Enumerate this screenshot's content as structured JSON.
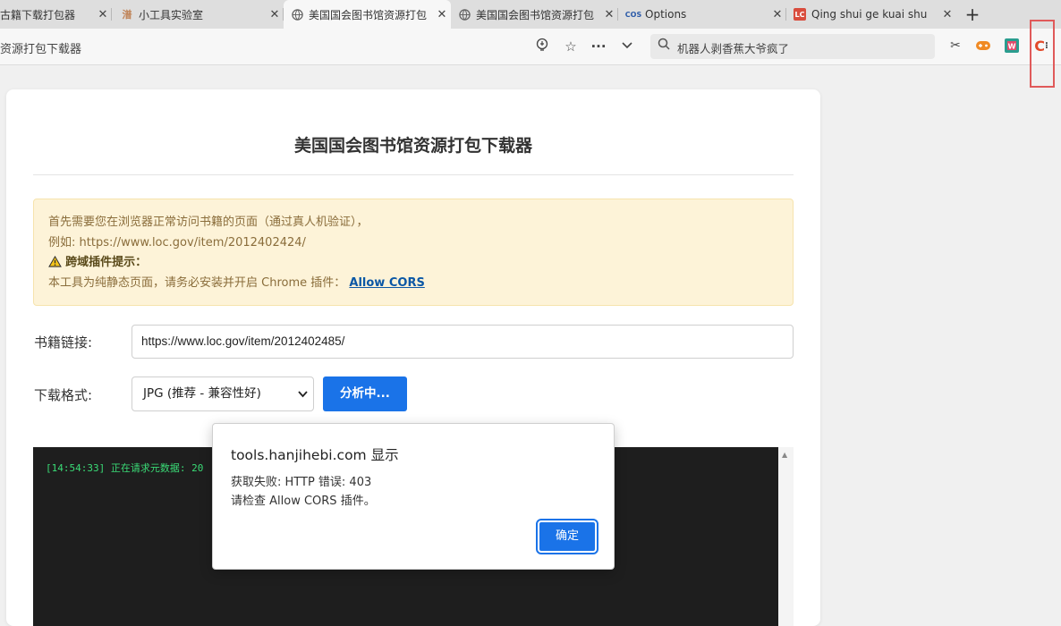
{
  "browser": {
    "tabs": [
      {
        "title": "古籍下载打包器",
        "favicon": "page-icon"
      },
      {
        "title": "小工具实验室",
        "favicon": "han-icon",
        "favicon_text": "潽"
      },
      {
        "title": "美国国会图书馆资源打包",
        "favicon": "globe-icon"
      },
      {
        "title": "美国国会图书馆资源打包",
        "favicon": "globe-icon"
      },
      {
        "title": "Options",
        "favicon": "cors-icon",
        "favicon_text": "COS"
      },
      {
        "title": "Qing shui ge kuai shu",
        "favicon": "loc-icon",
        "favicon_text": "LC"
      }
    ],
    "address_text": "资源打包下载器",
    "search_placeholder": "机器人剥香蕉大爷疯了"
  },
  "page": {
    "title": "美国国会图书馆资源打包下载器",
    "notice": {
      "line1": "首先需要您在浏览器正常访问书籍的页面（通过真人机验证），",
      "line2": "例如: https://www.loc.gov/item/2012402424/",
      "warn_title": "跨域插件提示：",
      "line4_prefix": "本工具为纯静态页面，请务必安装并开启 Chrome 插件：",
      "link": "Allow CORS"
    },
    "book_link_label": "书籍链接:",
    "book_link_value": "https://www.loc.gov/item/2012402485/",
    "format_label": "下载格式:",
    "format_value": "JPG (推荐 - 兼容性好)",
    "analyze_button": "分析中...",
    "console_line": "[14:54:33] 正在请求元数据: 20"
  },
  "dialog": {
    "title": "tools.hanjihebi.com 显示",
    "message_line1": "获取失败: HTTP 错误: 403",
    "message_line2": "请检查 Allow CORS 插件。",
    "ok_button": "确定"
  },
  "colors": {
    "accent": "#1a73e8",
    "notice_bg": "#fdf3d8",
    "console_bg": "#1e1e1e",
    "console_text": "#3adb76"
  }
}
